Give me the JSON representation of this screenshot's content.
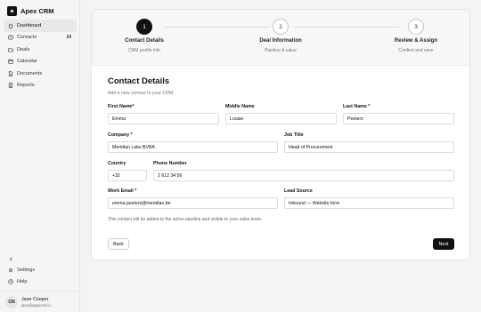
{
  "app": {
    "name": "Apex CRM"
  },
  "sidebar": {
    "items": [
      {
        "label": "Dashboard",
        "icon": "home-icon",
        "active": true
      },
      {
        "label": "Contacts",
        "icon": "contacts-icon",
        "badge": "24"
      },
      {
        "label": "Deals",
        "icon": "folder-icon"
      },
      {
        "label": "Calendar",
        "icon": "calendar-icon"
      },
      {
        "label": "Documents",
        "icon": "document-icon"
      },
      {
        "label": "Reports",
        "icon": "reports-icon"
      }
    ],
    "footer_items": [
      {
        "label": "Settings",
        "icon": "gear-icon"
      },
      {
        "label": "Help",
        "icon": "help-icon"
      }
    ],
    "user": {
      "initials": "CN",
      "name": "Jane Cooper",
      "email": "jane@apexcrm.io"
    }
  },
  "stepper": {
    "steps": [
      {
        "number": "1",
        "title": "Contact Details",
        "subtitle": "CRM profile info",
        "active": true
      },
      {
        "number": "2",
        "title": "Deal Information",
        "subtitle": "Pipeline & value"
      },
      {
        "number": "3",
        "title": "Review & Assign",
        "subtitle": "Confirm and save"
      }
    ]
  },
  "form": {
    "title": "Contact Details",
    "subtitle": "Add a new contact to your CRM",
    "fields": {
      "first_name": {
        "label": "First Name*",
        "value": "Emma"
      },
      "middle_name": {
        "label": "Middle Name",
        "value": "Louise"
      },
      "last_name": {
        "label": "Last Name *",
        "value": "Peeters"
      },
      "company": {
        "label": "Company *",
        "value": "Meridian Labs BVBA"
      },
      "job_title": {
        "label": "Job Title",
        "value": "Head of Procurement"
      },
      "country": {
        "label": "Country",
        "value": "+32"
      },
      "phone": {
        "label": "Phone Number",
        "value": "2 612 34 56"
      },
      "work_email": {
        "label": "Work Email *",
        "value": "emma.peeters@meridian.be"
      },
      "lead_source": {
        "label": "Lead Source",
        "value": "Inbound — Website form"
      }
    },
    "note": "This contact will be added to the active pipeline and visible to your sales team.",
    "back_label": "Back",
    "next_label": "Next"
  },
  "colors": {
    "accent": "#111111",
    "sidebar_bg": "#f5f5f5",
    "page_bg": "#f4f4f5"
  }
}
